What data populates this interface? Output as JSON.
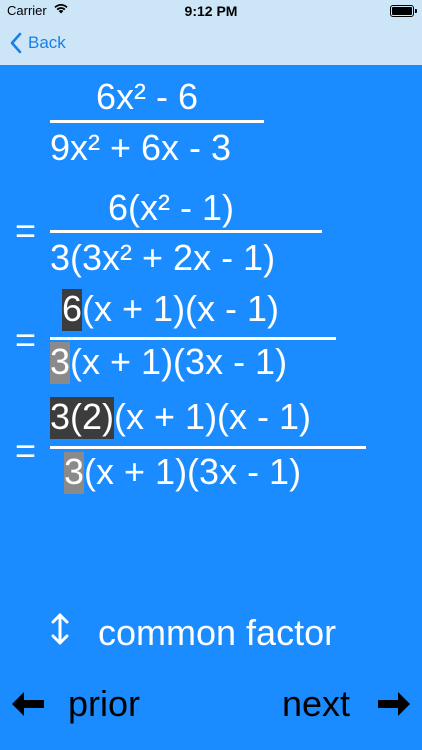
{
  "status": {
    "carrier": "Carrier",
    "time": "9:12 PM"
  },
  "nav": {
    "back_label": "Back"
  },
  "math": {
    "step0": {
      "num": "6x² - 6",
      "den": "9x² + 6x - 3"
    },
    "step1": {
      "eq": "=",
      "num": "6(x² - 1)",
      "den": "3(3x² + 2x - 1)"
    },
    "step2": {
      "eq": "=",
      "num_hl": "6",
      "num_rest": "(x + 1)(x - 1)",
      "den_hl": "3",
      "den_rest": "(x + 1)(3x - 1)"
    },
    "step3": {
      "eq": "=",
      "num_hl": "3(2)",
      "num_rest": "(x + 1)(x - 1)",
      "den_hl": "3",
      "den_rest": "(x + 1)(3x - 1)"
    }
  },
  "hint": {
    "icon": "up-down-arrows-icon",
    "label": "common factor"
  },
  "footer": {
    "prior_label": "prior",
    "next_label": "next"
  },
  "colors": {
    "background": "#1a8cff",
    "topbar": "#cde6f7",
    "link": "#1a7fe6",
    "highlight_dark": "#3c3c3c",
    "highlight_gray": "#8a8a8a"
  }
}
